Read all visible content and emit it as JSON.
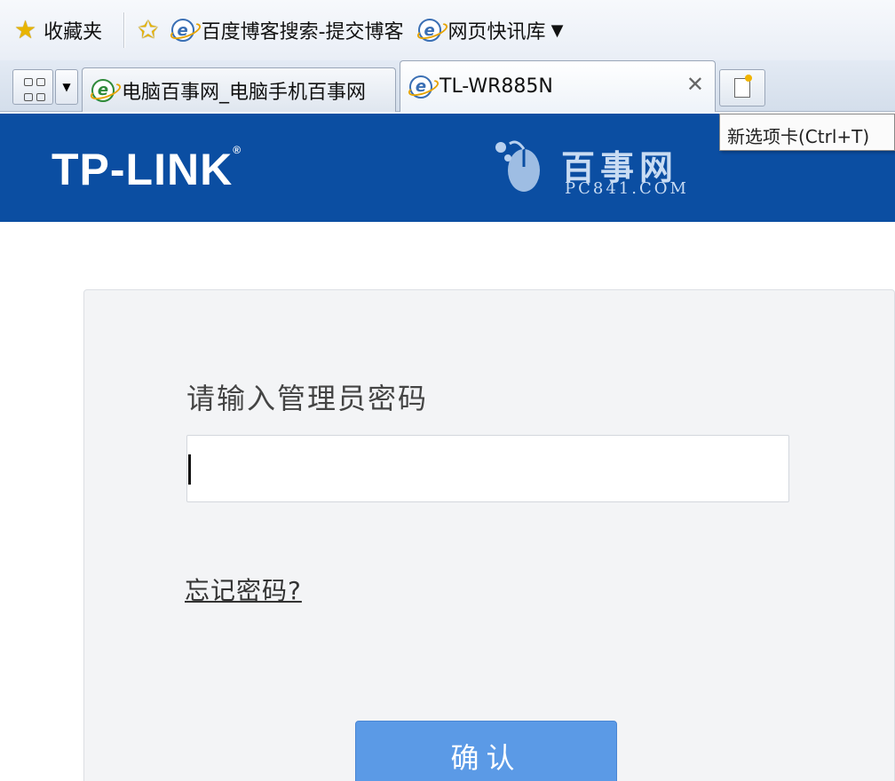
{
  "favorites_bar": {
    "favorites_label": "收藏夹",
    "links": [
      {
        "label": "百度博客搜索-提交博客",
        "icon": "ie-icon"
      },
      {
        "label": "网页快讯库",
        "icon": "ie-icon"
      }
    ]
  },
  "tabs": [
    {
      "title": "电脑百事网_电脑手机百事网",
      "active": false
    },
    {
      "title": "TL-WR885N",
      "active": true
    }
  ],
  "new_tab_tooltip": "新选项卡(Ctrl+T)",
  "header": {
    "brand": "TP-LINK",
    "brand_mark": "®",
    "watermark_cn": "百事网",
    "watermark_en": "PC841.COM",
    "color": "#0b4ea2"
  },
  "login": {
    "prompt": "请输入管理员密码",
    "password_value": "",
    "forgot_link": "忘记密码?",
    "confirm_button": "确认",
    "button_color": "#5b9ae6"
  }
}
